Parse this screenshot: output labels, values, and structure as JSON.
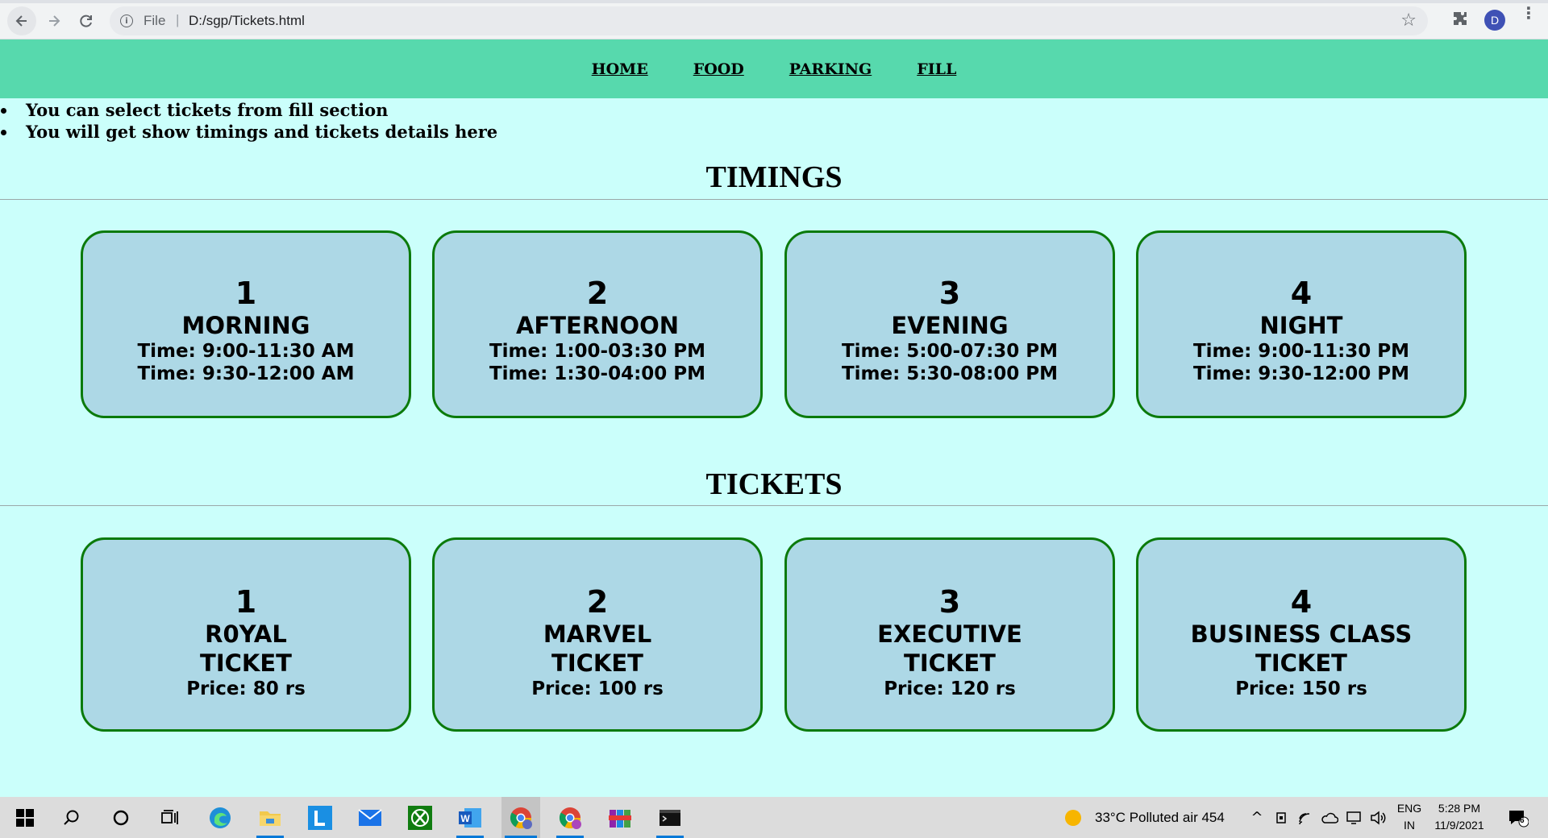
{
  "browser": {
    "scheme_label": "File",
    "separator": "|",
    "url": "D:/sgp/Tickets.html",
    "profile_initial": "D"
  },
  "nav": {
    "items": [
      "HOME",
      "FOOD",
      "PARKING",
      "FILL"
    ]
  },
  "notes": [
    "You can select tickets from fill section",
    "You will get show timings and tickets details here"
  ],
  "timings": {
    "title": "TIMINGS",
    "cards": [
      {
        "num": "1",
        "name": "MORNING",
        "line1": "Time: 9:00-11:30 AM",
        "line2": "Time: 9:30-12:00 AM"
      },
      {
        "num": "2",
        "name": "AFTERNOON",
        "line1": "Time: 1:00-03:30 PM",
        "line2": "Time: 1:30-04:00 PM"
      },
      {
        "num": "3",
        "name": "EVENING",
        "line1": "Time: 5:00-07:30 PM",
        "line2": "Time: 5:30-08:00 PM"
      },
      {
        "num": "4",
        "name": "NIGHT",
        "line1": "Time: 9:00-11:30 PM",
        "line2": "Time: 9:30-12:00 PM"
      }
    ]
  },
  "tickets": {
    "title": "TICKETS",
    "cards": [
      {
        "num": "1",
        "name": "R0YAL",
        "sub": "TICKET",
        "price": "Price: 80 rs"
      },
      {
        "num": "2",
        "name": "MARVEL",
        "sub": "TICKET",
        "price": "Price: 100 rs"
      },
      {
        "num": "3",
        "name": "EXECUTIVE",
        "sub": "TICKET",
        "price": "Price: 120 rs"
      },
      {
        "num": "4",
        "name": "BUSINESS CLASS",
        "sub": "TICKET",
        "price": "Price: 150 rs"
      }
    ]
  },
  "taskbar": {
    "weather": "33°C  Polluted air 454",
    "lang_top": "ENG",
    "lang_bottom": "IN",
    "time": "5:28 PM",
    "date": "11/9/2021",
    "notification_count": "6"
  },
  "colors": {
    "page_bg": "#cbfffb",
    "nav_bg": "#57d9ad",
    "card_bg": "#add8e6",
    "card_border": "#0b7a0b"
  }
}
